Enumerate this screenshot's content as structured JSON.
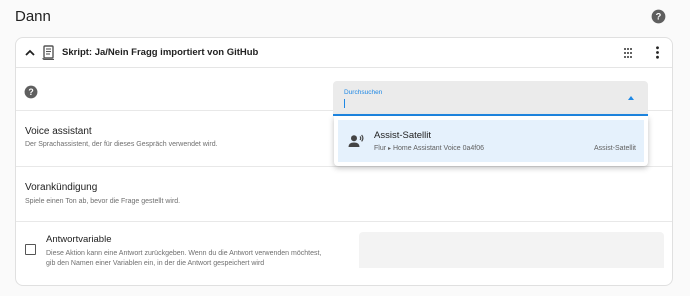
{
  "section": {
    "title": "Dann"
  },
  "card": {
    "title": "Skript: Ja/Nein Fragg importiert von GitHub"
  },
  "voice_assistant": {
    "label": "Voice assistant",
    "description": "Der Sprachassistent, der für dieses Gespräch verwendet wird.",
    "search_label": "Durchsuchen",
    "search_value": ""
  },
  "dropdown": {
    "options": [
      {
        "title": "Assist-Satellit",
        "area": "Flur",
        "device": "Home Assistant Voice 0a4f06",
        "domain": "Assist-Satellit",
        "icon": "speaker-voice-icon"
      }
    ]
  },
  "pre_announcement": {
    "label": "Vorankündigung",
    "description": "Spiele einen Ton ab, bevor die Frage gestellt wird."
  },
  "response_variable": {
    "label": "Antwortvariable",
    "description_line1": "Diese Aktion kann eine Antwort zurückgeben. Wenn du die Antwort verwenden möchtest,",
    "description_line2": "gib den Namen einer Variablen ein, in der die Antwort gespeichert wird",
    "checked": false,
    "value": ""
  },
  "colors": {
    "accent": "#1e88e5",
    "selected_option_bg": "#e5f1fc"
  }
}
